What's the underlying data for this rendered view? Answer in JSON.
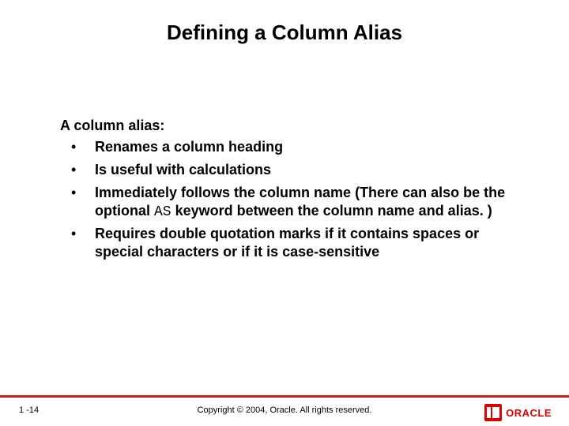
{
  "title": "Defining a Column Alias",
  "lead": "A column alias:",
  "bullets": [
    {
      "dot": "•",
      "pre": "Renames a column heading",
      "code": "",
      "post": ""
    },
    {
      "dot": "•",
      "pre": "Is useful with calculations",
      "code": "",
      "post": ""
    },
    {
      "dot": "•",
      "pre": "Immediately follows the column name (There can also be the optional ",
      "code": "AS",
      "post": " keyword between the column name and alias. )"
    },
    {
      "dot": "•",
      "pre": "Requires double quotation marks if it contains spaces or special characters or if it is case-sensitive",
      "code": "",
      "post": ""
    }
  ],
  "page_number": "1 -14",
  "copyright": "Copyright © 2004, Oracle.  All rights reserved.",
  "logo_text": "ORACLE"
}
